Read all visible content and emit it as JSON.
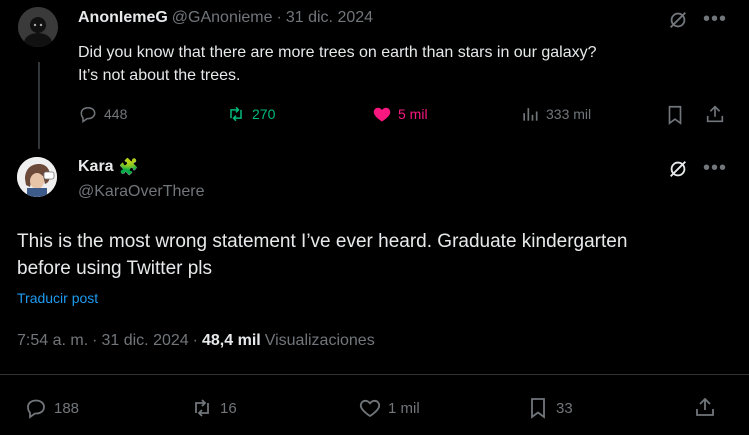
{
  "parent": {
    "name": "AnonIemeG",
    "handle": "@GAnonieme",
    "separator": "·",
    "date": "31 dic. 2024",
    "text_line1": "Did you know that there are more trees on earth than stars in our galaxy?",
    "text_line2": "It’s not about the trees.",
    "replies": "448",
    "retweets": "270",
    "likes": "5 mil",
    "views": "333 mil"
  },
  "reply": {
    "name": "Kara",
    "badge": "🧩",
    "handle": "@KaraOverThere",
    "text_line1": "This is the most wrong statement I’ve ever heard. Graduate kindergarten",
    "text_line2": "before using Twitter pls",
    "translate": "Traducir post",
    "time": "7:54 a. m.",
    "separator": "·",
    "date": "31 dic. 2024",
    "separator2": "·",
    "views_count": "48,4 mil",
    "views_label": "Visualizaciones",
    "replies": "188",
    "retweets": "16",
    "likes": "1 mil",
    "bookmarks": "33"
  },
  "colors": {
    "background": "#000000",
    "text": "#e7e9ea",
    "muted": "#71767b",
    "retweet": "#00ba7c",
    "like": "#f91880",
    "link": "#1d9bf0"
  }
}
